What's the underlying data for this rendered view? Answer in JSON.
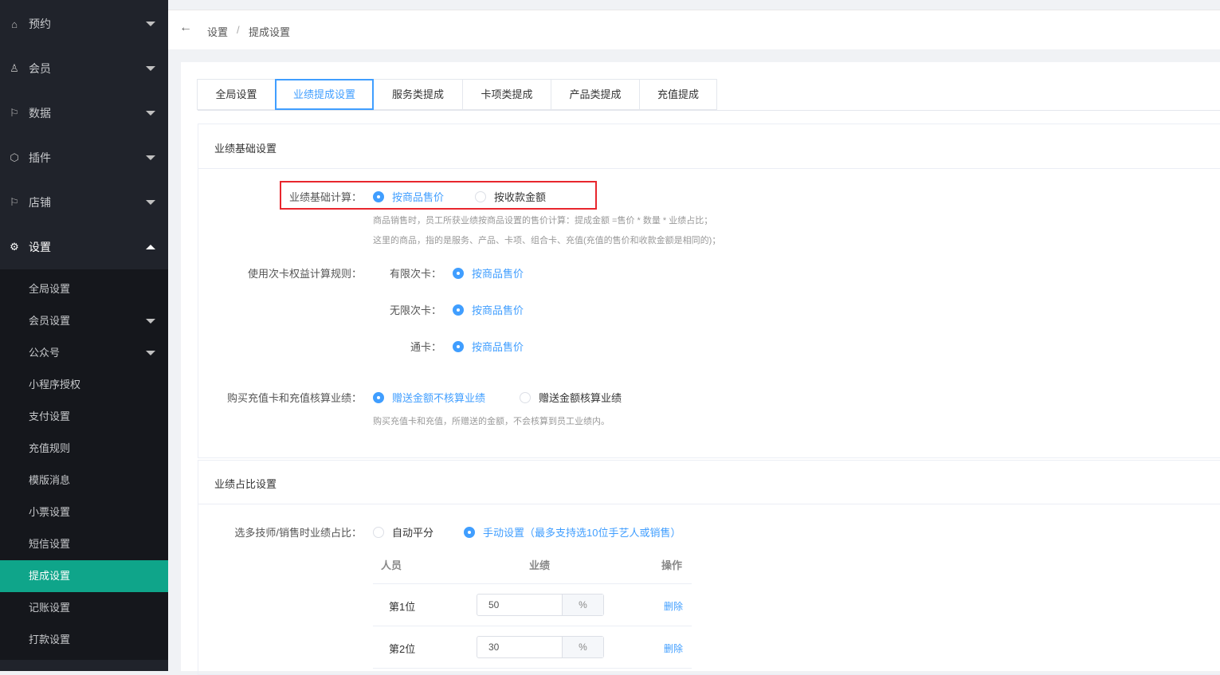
{
  "sidebar": {
    "menus": [
      {
        "label": "预约",
        "icon": "home-icon"
      },
      {
        "label": "会员",
        "icon": "user-icon"
      },
      {
        "label": "数据",
        "icon": "flag-icon"
      },
      {
        "label": "插件",
        "icon": "cube-icon"
      },
      {
        "label": "店铺",
        "icon": "flag-icon"
      },
      {
        "label": "设置",
        "icon": "gear-icon"
      }
    ],
    "submenu": [
      "全局设置",
      "会员设置",
      "公众号",
      "小程序授权",
      "支付设置",
      "充值规则",
      "模版消息",
      "小票设置",
      "短信设置",
      "提成设置",
      "记账设置",
      "打款设置"
    ],
    "active": "提成设置"
  },
  "breadcrumb": {
    "back": "←",
    "items": [
      "设置",
      "提成设置"
    ],
    "sep": "/"
  },
  "tabs": [
    "全局设置",
    "业绩提成设置",
    "服务类提成",
    "卡项类提成",
    "产品类提成",
    "充值提成"
  ],
  "basic": {
    "title": "业绩基础设置",
    "calc_label": "业绩基础计算：",
    "calc_opts": [
      "按商品售价",
      "按收款金额"
    ],
    "hint1": "商品销售时，员工所获业绩按商品设置的售价计算：提成金额 =售价 * 数量 * 业绩占比；",
    "hint2": "这里的商品，指的是服务、产品、卡项、组合卡、充值(充值的售价和收款金额是相同的)；",
    "card_rule_label": "使用次卡权益计算规则：",
    "card_rules": [
      {
        "label": "有限次卡：",
        "value": "按商品售价"
      },
      {
        "label": "无限次卡：",
        "value": "按商品售价"
      },
      {
        "label": "通卡：",
        "value": "按商品售价"
      }
    ],
    "recharge_label": "购买充值卡和充值核算业绩：",
    "recharge_opts": [
      "赠送金额不核算业绩",
      "赠送金额核算业绩"
    ],
    "recharge_hint": "购买充值卡和充值，所赠送的金额，不会核算到员工业绩内。"
  },
  "ratio": {
    "title": "业绩占比设置",
    "label": "选多技师/销售时业绩占比：",
    "opts": [
      "自动平分",
      "手动设置（最多支持选10位手艺人或销售）"
    ],
    "headers": [
      "人员",
      "业绩",
      "操作"
    ],
    "rows": [
      {
        "name": "第1位",
        "value": "50",
        "unit": "%",
        "action": "删除"
      },
      {
        "name": "第2位",
        "value": "30",
        "unit": "%",
        "action": "删除"
      }
    ]
  }
}
